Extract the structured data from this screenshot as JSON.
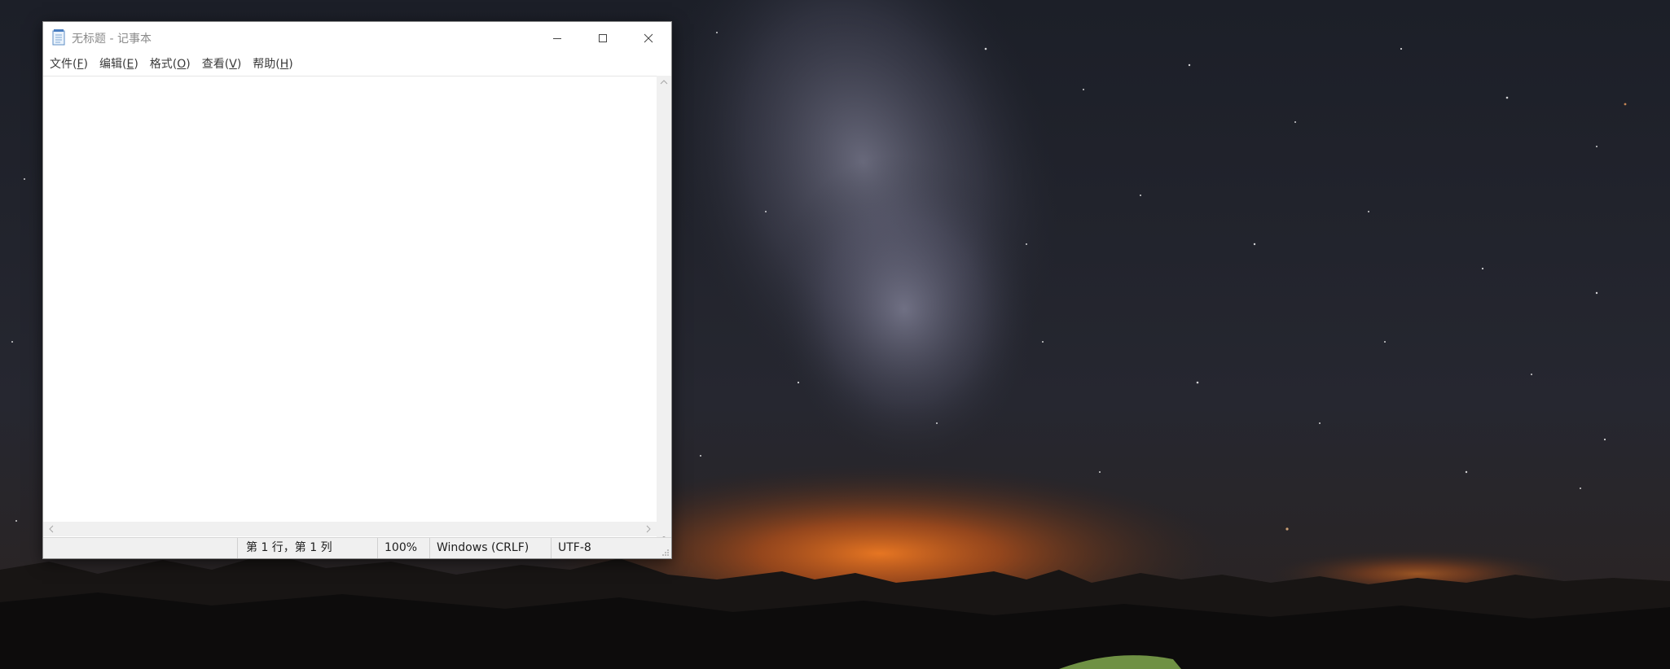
{
  "window": {
    "title": "无标题 - 记事本",
    "app_icon": "notepad-icon"
  },
  "title_buttons": {
    "minimize_icon": "minimize-icon",
    "maximize_icon": "maximize-icon",
    "close_icon": "close-icon"
  },
  "menu": {
    "items": [
      {
        "label": "文件",
        "key": "F"
      },
      {
        "label": "编辑",
        "key": "E"
      },
      {
        "label": "格式",
        "key": "O"
      },
      {
        "label": "查看",
        "key": "V"
      },
      {
        "label": "帮助",
        "key": "H"
      }
    ]
  },
  "editor": {
    "content": ""
  },
  "status": {
    "position": "第 1 行，第 1 列",
    "zoom": "100%",
    "line_ending": "Windows (CRLF)",
    "encoding": "UTF-8"
  },
  "colors": {
    "window_bg": "#ffffff",
    "statusbar_bg": "#f0f0f0",
    "sky_glow": "#e8641a"
  }
}
